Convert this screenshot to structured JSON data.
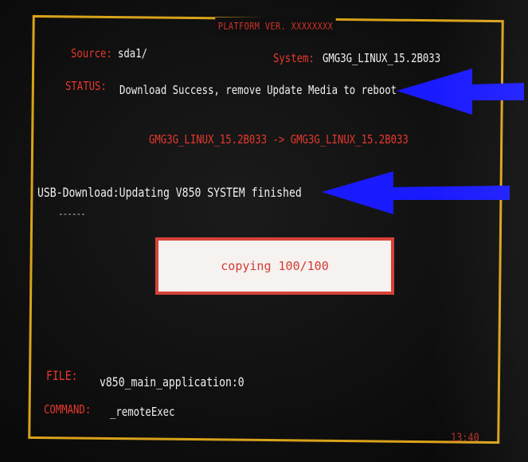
{
  "header": {
    "platform_version": "PLATFORM VER. XXXXXXXX"
  },
  "info": {
    "source_label": "Source:",
    "source_value": "sda1/",
    "system_label": "System:",
    "system_value": "GMG3G_LINUX_15.2B033"
  },
  "status": {
    "label": "STATUS:",
    "text": "Download Success, remove Update Media to reboot"
  },
  "version_transition": "GMG3G_LINUX_15.2B033 -> GMG3G_LINUX_15.2B033",
  "usb_message": "USB-Download:Updating V850 SYSTEM finished",
  "progress_dashes": "------",
  "progress": {
    "label": "copying 100/100",
    "fraction": 1.0
  },
  "file": {
    "label": "FILE:",
    "value": "v850_main_application:0"
  },
  "command": {
    "label": "COMMAND:",
    "value": "_remoteExec"
  },
  "clock": "13:40",
  "colors": {
    "frame": "#d9a21a",
    "label_red": "#e6382d",
    "text_white": "#f0f0f0",
    "arrow_blue": "#1a1aff"
  },
  "icons": {
    "status_arrow": "left-arrow-icon",
    "usb_arrow": "left-arrow-icon"
  }
}
